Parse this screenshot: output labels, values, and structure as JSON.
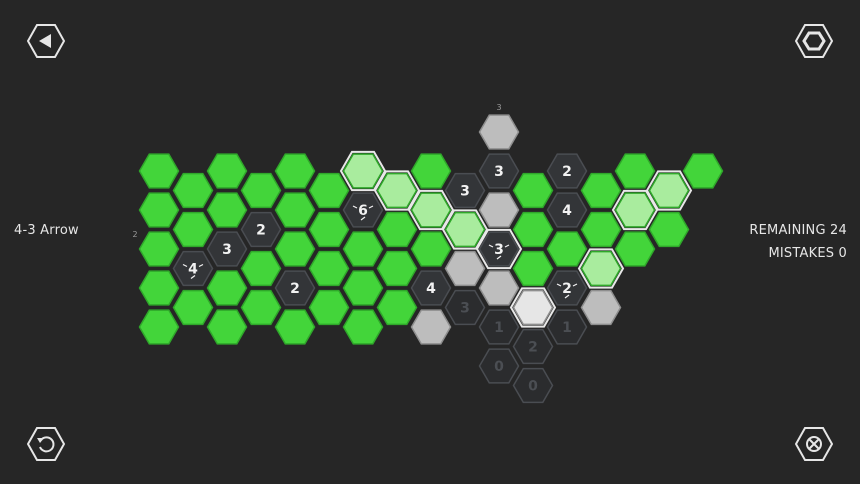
{
  "level": {
    "name": "4-3 Arrow"
  },
  "stats": {
    "remaining_text": "REMAINING 24",
    "mistakes_text": "MISTAKES 0"
  },
  "icons": {
    "back": "play-reverse-icon",
    "settings": "hexagon-settings-icon",
    "reset": "undo-icon",
    "close": "crossed-circle-icon"
  },
  "colors": {
    "background": "#262626",
    "blue_cell": "#43d53a",
    "blue_highlight": "#a9ec9e",
    "dark_cell": "#333538",
    "dark_cell_faded": "#2b2c2e",
    "orange_cell": "#bdbdbd",
    "outline": "#e8e8e8"
  },
  "board": {
    "column_hints": [
      {
        "text": "3",
        "col": 10,
        "top": true
      },
      {
        "text": "2",
        "col": 0,
        "side": true
      }
    ],
    "cells": [
      {
        "c": 0,
        "r": 0,
        "t": "g"
      },
      {
        "c": 0,
        "r": 1,
        "t": "g"
      },
      {
        "c": 0,
        "r": 2,
        "t": "g"
      },
      {
        "c": 0,
        "r": 3,
        "t": "g"
      },
      {
        "c": 0,
        "r": 4,
        "t": "g"
      },
      {
        "c": 1,
        "r": 0,
        "t": "g"
      },
      {
        "c": 1,
        "r": 1,
        "t": "g"
      },
      {
        "c": 1,
        "r": 2,
        "t": "d",
        "n": "4",
        "hint": true
      },
      {
        "c": 1,
        "r": 3,
        "t": "g"
      },
      {
        "c": 2,
        "r": 0,
        "t": "g"
      },
      {
        "c": 2,
        "r": 1,
        "t": "g"
      },
      {
        "c": 2,
        "r": 2,
        "t": "d",
        "n": "3"
      },
      {
        "c": 2,
        "r": 3,
        "t": "g"
      },
      {
        "c": 2,
        "r": 4,
        "t": "g"
      },
      {
        "c": 3,
        "r": 0,
        "t": "g"
      },
      {
        "c": 3,
        "r": 1,
        "t": "d",
        "n": "2"
      },
      {
        "c": 3,
        "r": 2,
        "t": "g"
      },
      {
        "c": 3,
        "r": 3,
        "t": "g"
      },
      {
        "c": 4,
        "r": 0,
        "t": "g"
      },
      {
        "c": 4,
        "r": 1,
        "t": "g"
      },
      {
        "c": 4,
        "r": 2,
        "t": "g"
      },
      {
        "c": 4,
        "r": 3,
        "t": "d",
        "n": "2"
      },
      {
        "c": 4,
        "r": 4,
        "t": "g"
      },
      {
        "c": 5,
        "r": 0,
        "t": "g"
      },
      {
        "c": 5,
        "r": 1,
        "t": "g"
      },
      {
        "c": 5,
        "r": 2,
        "t": "g"
      },
      {
        "c": 5,
        "r": 3,
        "t": "g"
      },
      {
        "c": 6,
        "r": 0,
        "t": "gh",
        "o": true
      },
      {
        "c": 6,
        "r": 1,
        "t": "d",
        "n": "6",
        "hint": true
      },
      {
        "c": 6,
        "r": 2,
        "t": "g"
      },
      {
        "c": 6,
        "r": 3,
        "t": "g"
      },
      {
        "c": 6,
        "r": 4,
        "t": "g"
      },
      {
        "c": 7,
        "r": 0,
        "t": "gh",
        "o": true
      },
      {
        "c": 7,
        "r": 1,
        "t": "g"
      },
      {
        "c": 7,
        "r": 2,
        "t": "g"
      },
      {
        "c": 7,
        "r": 3,
        "t": "g"
      },
      {
        "c": 8,
        "r": 0,
        "t": "g"
      },
      {
        "c": 8,
        "r": 1,
        "t": "gh",
        "o": true
      },
      {
        "c": 8,
        "r": 2,
        "t": "g"
      },
      {
        "c": 8,
        "r": 3,
        "t": "d",
        "n": "4"
      },
      {
        "c": 8,
        "r": 4,
        "t": "o"
      },
      {
        "c": 9,
        "r": 0,
        "t": "d",
        "n": "3"
      },
      {
        "c": 9,
        "r": 1,
        "t": "gh",
        "o": true
      },
      {
        "c": 9,
        "r": 2,
        "t": "o"
      },
      {
        "c": 9,
        "r": 3,
        "t": "f",
        "n": "3"
      },
      {
        "c": 10,
        "r": -1,
        "t": "o"
      },
      {
        "c": 10,
        "r": 0,
        "t": "d",
        "n": "3"
      },
      {
        "c": 10,
        "r": 1,
        "t": "o"
      },
      {
        "c": 10,
        "r": 2,
        "t": "d",
        "n": "3",
        "o": true,
        "hint": true
      },
      {
        "c": 10,
        "r": 3,
        "t": "o"
      },
      {
        "c": 10,
        "r": 4,
        "t": "f",
        "n": "1"
      },
      {
        "c": 10,
        "r": 5,
        "t": "f",
        "n": "0"
      },
      {
        "c": 11,
        "r": 0,
        "t": "g"
      },
      {
        "c": 11,
        "r": 1,
        "t": "g"
      },
      {
        "c": 11,
        "r": 2,
        "t": "g"
      },
      {
        "c": 11,
        "r": 3,
        "t": "oh",
        "o": true
      },
      {
        "c": 11,
        "r": 4,
        "t": "f",
        "n": "2"
      },
      {
        "c": 11,
        "r": 5,
        "t": "f",
        "n": "0"
      },
      {
        "c": 12,
        "r": 0,
        "t": "d",
        "n": "2"
      },
      {
        "c": 12,
        "r": 1,
        "t": "d",
        "n": "4"
      },
      {
        "c": 12,
        "r": 2,
        "t": "g"
      },
      {
        "c": 12,
        "r": 3,
        "t": "d",
        "n": "2",
        "hint": true
      },
      {
        "c": 12,
        "r": 4,
        "t": "f",
        "n": "1"
      },
      {
        "c": 13,
        "r": 0,
        "t": "g"
      },
      {
        "c": 13,
        "r": 1,
        "t": "g"
      },
      {
        "c": 13,
        "r": 2,
        "t": "gh",
        "o": true
      },
      {
        "c": 13,
        "r": 3,
        "t": "o"
      },
      {
        "c": 14,
        "r": 0,
        "t": "g"
      },
      {
        "c": 14,
        "r": 1,
        "t": "gh",
        "o": true
      },
      {
        "c": 14,
        "r": 2,
        "t": "g"
      },
      {
        "c": 15,
        "r": 0,
        "t": "gh",
        "o": true
      },
      {
        "c": 15,
        "r": 1,
        "t": "g"
      },
      {
        "c": 16,
        "r": 0,
        "t": "g"
      }
    ]
  }
}
